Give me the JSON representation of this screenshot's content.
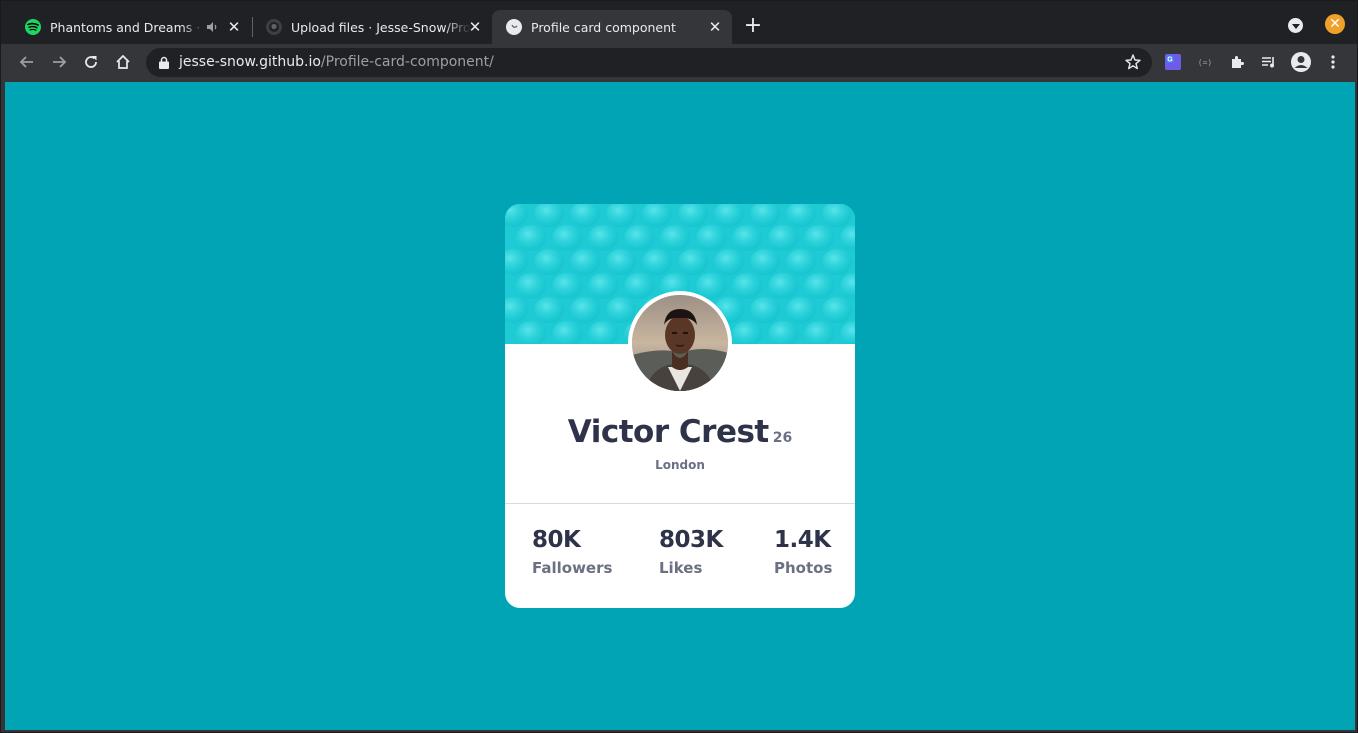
{
  "browser": {
    "tabs": [
      {
        "title": "Phantoms and Dreams · Ka",
        "icon": "spotify-icon",
        "has_audio": true,
        "active": false
      },
      {
        "title": "Upload files · Jesse-Snow/Pro",
        "icon": "github-icon",
        "active": false
      },
      {
        "title": "Profile card component",
        "icon": "site-favicon",
        "active": true
      }
    ],
    "url_host": "jesse-snow.github.io",
    "url_path": "/Profile-card-component/"
  },
  "colors": {
    "page_background": "#00a4b4",
    "banner": "#1ecad4",
    "heading_text": "#2e3349",
    "muted_text": "#6b7082",
    "window_close": "#f0a12a",
    "spotify": "#1ed760"
  },
  "profile": {
    "name": "Victor Crest",
    "age": "26",
    "city": "London",
    "stats": [
      {
        "value": "80K",
        "label": "Fallowers"
      },
      {
        "value": "803K",
        "label": "Likes"
      },
      {
        "value": "1.4K",
        "label": "Photos"
      }
    ]
  }
}
